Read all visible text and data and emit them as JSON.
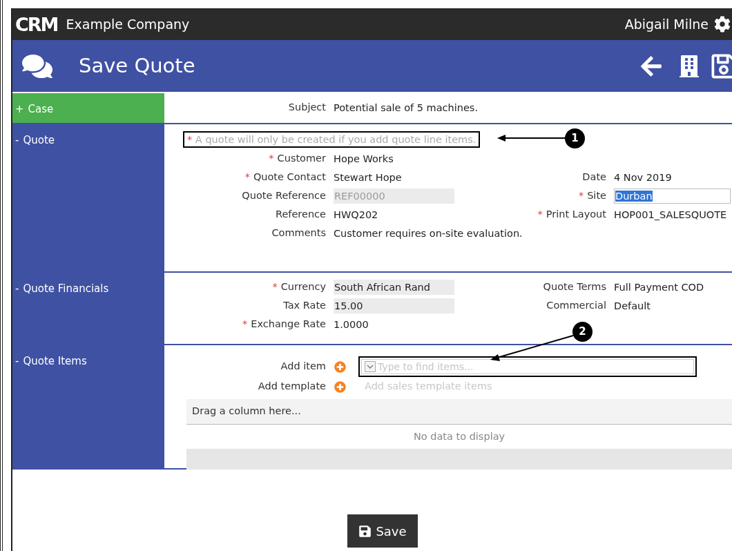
{
  "topbar": {
    "logo": "CRM",
    "company": "Example Company",
    "user": "Abigail Milne"
  },
  "header": {
    "title": "Save Quote"
  },
  "sections": [
    {
      "toggle": "+",
      "label": "Case",
      "color": "#4caf50",
      "rows": [
        {
          "left": {
            "label": "Subject",
            "required": false,
            "value": "Potential sale of 5 machines.",
            "kind": "text"
          }
        }
      ]
    },
    {
      "toggle": "-",
      "label": "Quote",
      "color": "#3f51a3",
      "note": {
        "marker": "*",
        "text": "A quote will only be created if you add quote line items."
      },
      "rows": [
        {
          "left": {
            "label": "Customer",
            "required": true,
            "value": "Hope Works",
            "kind": "text"
          }
        },
        {
          "left": {
            "label": "Quote Contact",
            "required": true,
            "value": "Stewart Hope",
            "kind": "text"
          },
          "right": {
            "label": "Date",
            "required": false,
            "value": "4 Nov 2019",
            "kind": "text"
          }
        },
        {
          "left": {
            "label": "Quote Reference",
            "required": false,
            "value": "REF00000",
            "kind": "disabled"
          },
          "right": {
            "label": "Site",
            "required": true,
            "value": "Durban",
            "kind": "highlighted"
          }
        },
        {
          "left": {
            "label": "Reference",
            "required": false,
            "value": "HWQ202",
            "kind": "text"
          },
          "right": {
            "label": "Print Layout",
            "required": true,
            "value": "HOP001_SALESQUOTE",
            "kind": "text"
          }
        },
        {
          "left": {
            "label": "Comments",
            "required": false,
            "value": "Customer requires on-site evaluation.",
            "kind": "text"
          }
        }
      ]
    },
    {
      "toggle": "-",
      "label": "Quote Financials",
      "color": "#3f51a3",
      "rows": [
        {
          "left": {
            "label": "Currency",
            "required": true,
            "value": "South African Rand",
            "kind": "shaded"
          },
          "right": {
            "label": "Quote Terms",
            "required": false,
            "value": "Full Payment COD",
            "kind": "text"
          }
        },
        {
          "left": {
            "label": "Tax Rate",
            "required": false,
            "value": "15.00",
            "kind": "shaded"
          },
          "right": {
            "label": "Commercial",
            "required": false,
            "value": "Default",
            "kind": "text"
          }
        },
        {
          "left": {
            "label": "Exchange Rate",
            "required": true,
            "value": "1.0000",
            "kind": "text"
          }
        }
      ]
    },
    {
      "toggle": "-",
      "label": "Quote Items",
      "color": "#3f51a3",
      "items": {
        "add_item": {
          "label": "Add item",
          "placeholder": "Type to find items..."
        },
        "add_template": {
          "label": "Add template",
          "text": "Add sales template items"
        },
        "grid": {
          "group_hint": "Drag a column here...",
          "empty": "No data to display"
        }
      }
    }
  ],
  "callouts": [
    "1",
    "2"
  ],
  "save_button": "Save"
}
